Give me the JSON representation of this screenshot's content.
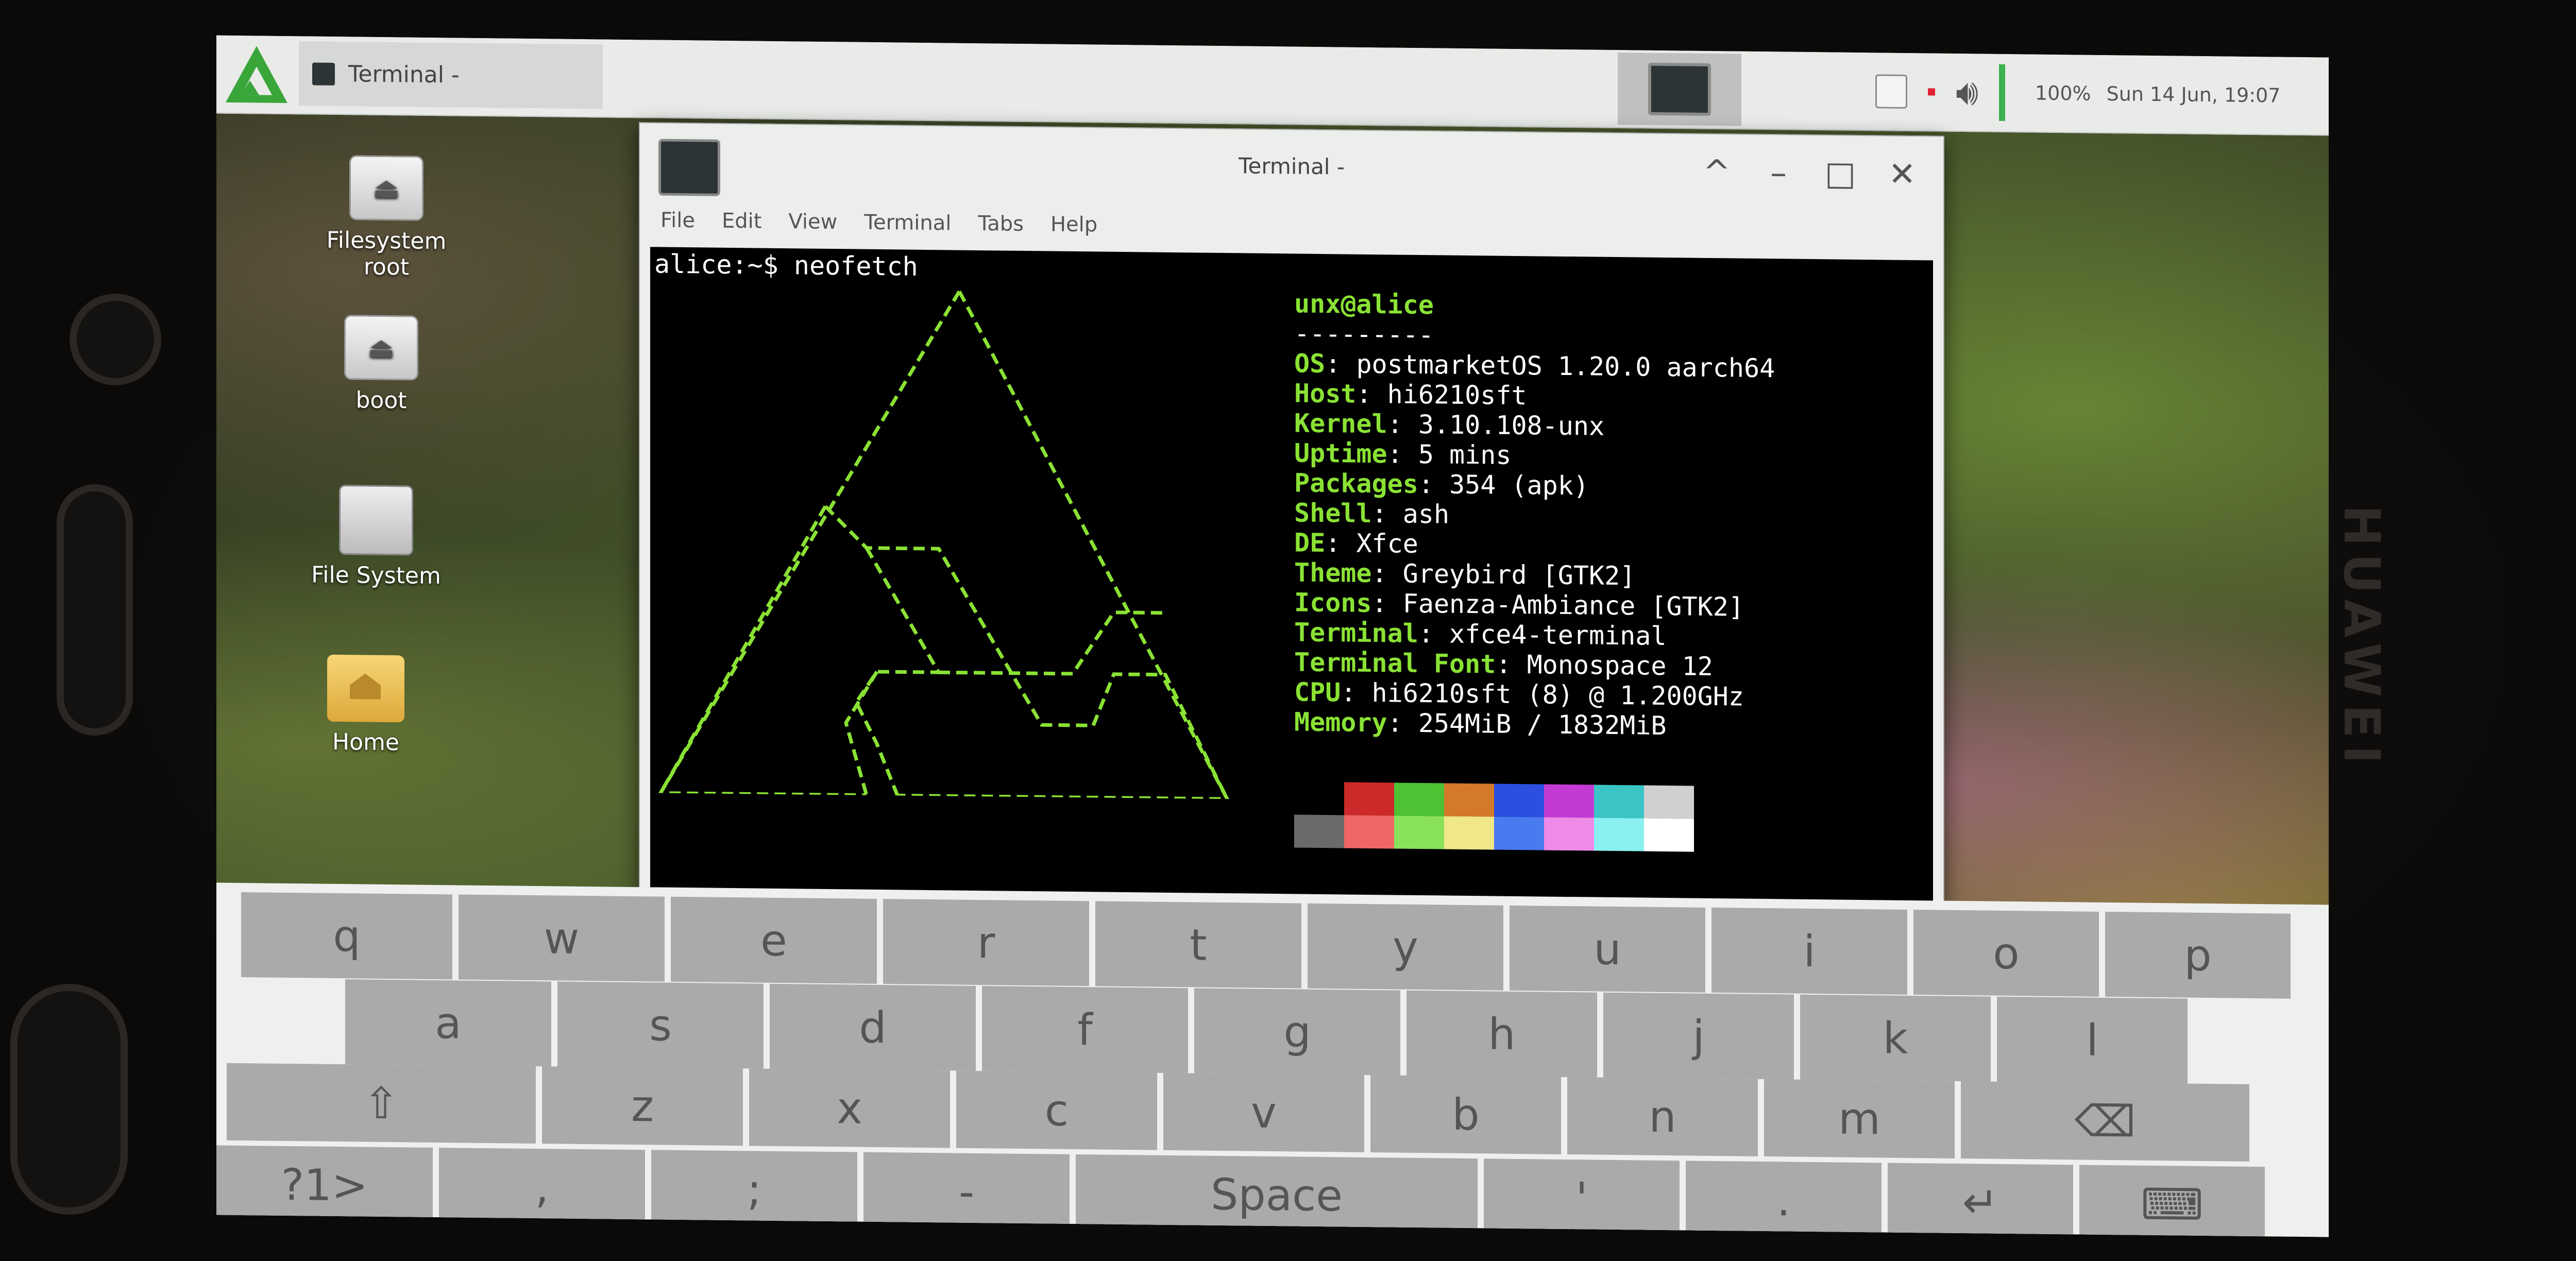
{
  "device": {
    "brand": "HUAWEI"
  },
  "panel": {
    "task_label": "Terminal -",
    "clock": "Sun 14 Jun, 19:07",
    "battery": "100%"
  },
  "desktop_icons": [
    {
      "label": "Filesystem root",
      "kind": "drive"
    },
    {
      "label": "boot",
      "kind": "drive"
    },
    {
      "label": "File System",
      "kind": "hdd"
    },
    {
      "label": "Home",
      "kind": "folder"
    }
  ],
  "window": {
    "title": "Terminal -",
    "menu": [
      "File",
      "Edit",
      "View",
      "Terminal",
      "Tabs",
      "Help"
    ],
    "controls": {
      "up": "^",
      "minimize": "–",
      "maximize": "□",
      "close": "✕"
    }
  },
  "terminal": {
    "prompt": "alice:~$ neofetch",
    "user_host": "unx@alice",
    "separator": "---------",
    "info": [
      {
        "key": "OS",
        "value": "postmarketOS 1.20.0 aarch64"
      },
      {
        "key": "Host",
        "value": "hi6210sft"
      },
      {
        "key": "Kernel",
        "value": "3.10.108-unx"
      },
      {
        "key": "Uptime",
        "value": "5 mins"
      },
      {
        "key": "Packages",
        "value": "354 (apk)"
      },
      {
        "key": "Shell",
        "value": "ash"
      },
      {
        "key": "DE",
        "value": "Xfce"
      },
      {
        "key": "Theme",
        "value": "Greybird [GTK2]"
      },
      {
        "key": "Icons",
        "value": "Faenza-Ambiance [GTK2]"
      },
      {
        "key": "Terminal",
        "value": "xfce4-terminal"
      },
      {
        "key": "Terminal Font",
        "value": "Monospace 12"
      },
      {
        "key": "CPU",
        "value": "hi6210sft (8) @ 1.200GHz"
      },
      {
        "key": "Memory",
        "value": "254MiB / 1832MiB"
      }
    ],
    "palette_top": [
      "#000000",
      "#cc2a2a",
      "#4fc234",
      "#d4782a",
      "#2c4fe0",
      "#c43ad4",
      "#3ac4c4",
      "#d0d0d0"
    ],
    "palette_bottom": [
      "#6a6a6a",
      "#f06666",
      "#8ae25a",
      "#f0e68a",
      "#4a7af0",
      "#f08ae8",
      "#8af0f0",
      "#ffffff"
    ]
  },
  "keyboard": {
    "row1": [
      "q",
      "w",
      "e",
      "r",
      "t",
      "y",
      "u",
      "i",
      "o",
      "p"
    ],
    "row2": [
      "a",
      "s",
      "d",
      "f",
      "g",
      "h",
      "j",
      "k",
      "l"
    ],
    "row3": [
      "⇧",
      "z",
      "x",
      "c",
      "v",
      "b",
      "n",
      "m",
      "⌫"
    ],
    "row4": [
      "?1>",
      ",",
      ";",
      "-",
      "Space",
      "'",
      ".",
      "↵",
      "⌨"
    ]
  }
}
